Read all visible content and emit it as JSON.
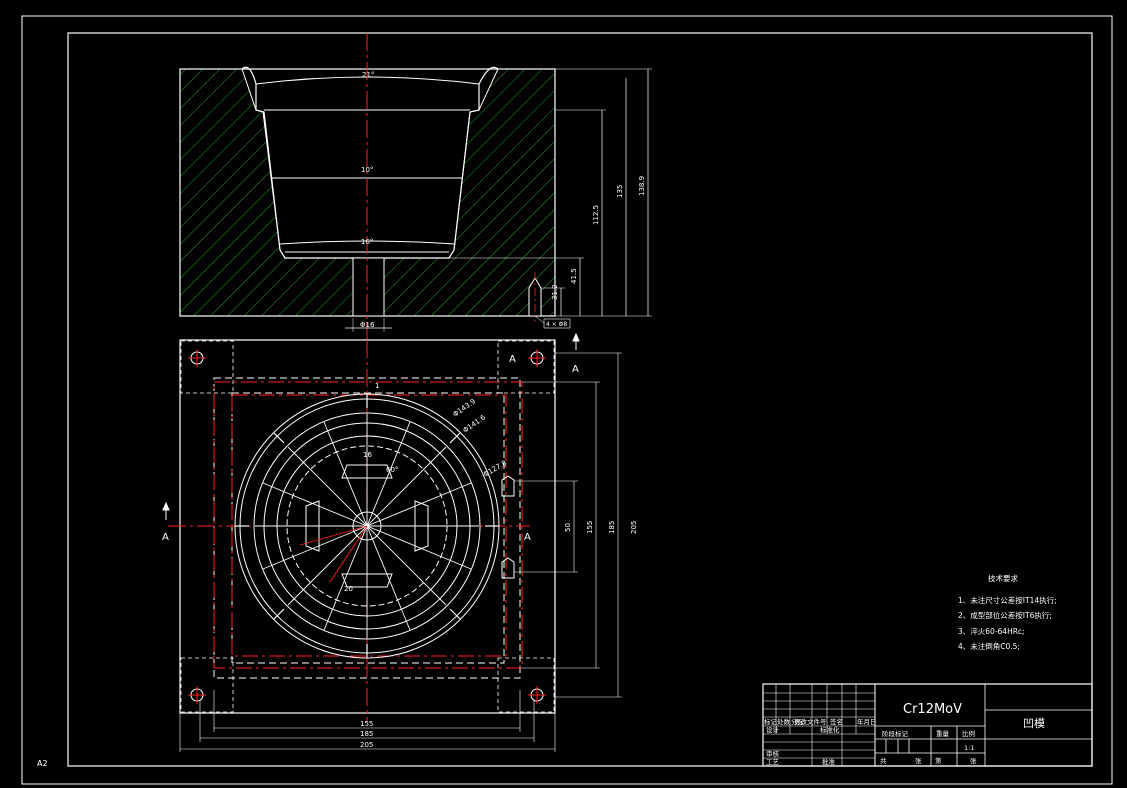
{
  "sheet": {
    "size_label": "A2"
  },
  "section_view": {
    "angle_top": "21°",
    "angle_mid": "10°",
    "angle_bottom": "16°",
    "dim_112_5": "112.5",
    "dim_135": "135",
    "dim_138_9": "138.9",
    "dim_41_5": "41.5",
    "dim_31_2": "31.2",
    "dim_hole": "Φ16",
    "dim_pin": "4 × Φ8"
  },
  "plan_view": {
    "section_mark": "A",
    "dim_top_1": "1",
    "dim_r1": "Φ143.9",
    "dim_r2": "Φ141.6",
    "dim_r3": "Φ127.8",
    "dim_16": "16",
    "dim_60": "60°",
    "dim_20": "20",
    "dim_50": "50",
    "dim_155": "155",
    "dim_185": "185",
    "dim_205": "205"
  },
  "tech_notes": {
    "title": "技术要求",
    "items": [
      "1、未注尺寸公差按IT14执行;",
      "2、成型部位公差按IT6执行;",
      "3、淬火60-64HRc;",
      "4、未注倒角C0.5;"
    ]
  },
  "title_block": {
    "material": "Cr12MoV",
    "part_name": "凹模",
    "scale": "1:1",
    "labels": {
      "mark": "标记",
      "count": "处数",
      "zone": "分区",
      "change_doc": "更改文件号",
      "sign": "签名",
      "date": "年月日",
      "design": "设计",
      "standardize": "标准化",
      "review": "审核",
      "process": "工艺",
      "approve": "批准",
      "stage_mark": "阶段标记",
      "weight": "重量",
      "ratio": "比例",
      "total": "共",
      "sheet_unit": "张",
      "page": "第"
    }
  },
  "colors": {
    "line": "#ffffff",
    "center": "#ff2020",
    "hatch": "#33cc33",
    "background": "#000000"
  }
}
